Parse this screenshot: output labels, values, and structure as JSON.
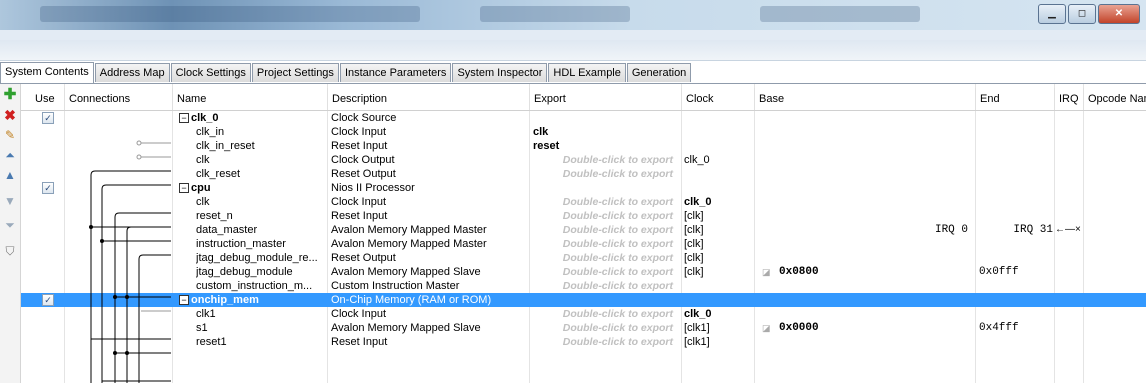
{
  "tabs": [
    "System Contents",
    "Address Map",
    "Clock Settings",
    "Project Settings",
    "Instance Parameters",
    "System Inspector",
    "HDL Example",
    "Generation"
  ],
  "columns": {
    "use": "Use",
    "connections": "Connections",
    "name": "Name",
    "description": "Description",
    "export": "Export",
    "clock": "Clock",
    "base": "Base",
    "end": "End",
    "irq": "IRQ",
    "opcode": "Opcode Nam"
  },
  "rows": [
    {
      "name": "clk_0",
      "desc": "Clock Source",
      "export": "",
      "clock": "",
      "base": "",
      "end": "",
      "top": true,
      "use": true,
      "selected": false
    },
    {
      "name": "clk_in",
      "desc": "Clock Input",
      "export": "clk",
      "clock": "",
      "base": "",
      "end": ""
    },
    {
      "name": "clk_in_reset",
      "desc": "Reset Input",
      "export": "reset",
      "clock": "",
      "base": "",
      "end": ""
    },
    {
      "name": "clk",
      "desc": "Clock Output",
      "export": "Double-click to export",
      "clock": "clk_0",
      "base": "",
      "end": ""
    },
    {
      "name": "clk_reset",
      "desc": "Reset Output",
      "export": "Double-click to export",
      "clock": "",
      "base": "",
      "end": ""
    },
    {
      "name": "cpu",
      "desc": "Nios II Processor",
      "export": "",
      "clock": "",
      "base": "",
      "end": "",
      "top": true,
      "use": true,
      "selected": false
    },
    {
      "name": "clk",
      "desc": "Clock Input",
      "export": "Double-click to export",
      "clock": "clk_0",
      "base": "",
      "end": "",
      "clockBold": true
    },
    {
      "name": "reset_n",
      "desc": "Reset Input",
      "export": "Double-click to export",
      "clock": "[clk]",
      "base": "",
      "end": ""
    },
    {
      "name": "data_master",
      "desc": "Avalon Memory Mapped Master",
      "export": "Double-click to export",
      "clock": "[clk]",
      "base": "IRQ 0",
      "end": "IRQ 31",
      "irq": "←—×"
    },
    {
      "name": "instruction_master",
      "desc": "Avalon Memory Mapped Master",
      "export": "Double-click to export",
      "clock": "[clk]",
      "base": "",
      "end": ""
    },
    {
      "name": "jtag_debug_module_re...",
      "desc": "Reset Output",
      "export": "Double-click to export",
      "clock": "[clk]",
      "base": "",
      "end": ""
    },
    {
      "name": "jtag_debug_module",
      "desc": "Avalon Memory Mapped Slave",
      "export": "Double-click to export",
      "clock": "[clk]",
      "base": "0x0800",
      "end": "0x0fff"
    },
    {
      "name": "custom_instruction_m...",
      "desc": "Custom Instruction Master",
      "export": "Double-click to export",
      "clock": "",
      "base": "",
      "end": ""
    },
    {
      "name": "onchip_mem",
      "desc": "On-Chip Memory (RAM or ROM)",
      "export": "",
      "clock": "",
      "base": "",
      "end": "",
      "top": true,
      "use": true,
      "selected": true
    },
    {
      "name": "clk1",
      "desc": "Clock Input",
      "export": "Double-click to export",
      "clock": "clk_0",
      "base": "",
      "end": "",
      "clockBold": true
    },
    {
      "name": "s1",
      "desc": "Avalon Memory Mapped Slave",
      "export": "Double-click to export",
      "clock": "[clk1]",
      "base": "0x0000",
      "end": "0x4fff"
    },
    {
      "name": "reset1",
      "desc": "Reset Input",
      "export": "Double-click to export",
      "clock": "[clk1]",
      "base": "",
      "end": ""
    }
  ],
  "colors": {
    "selection": "#3399ff",
    "ghost": "#c0c0c0"
  },
  "icons": [
    "add-icon",
    "remove-icon",
    "edit-icon",
    "move-top-icon",
    "move-up-icon",
    "move-down-icon",
    "move-bottom-icon",
    "filter-icon"
  ]
}
